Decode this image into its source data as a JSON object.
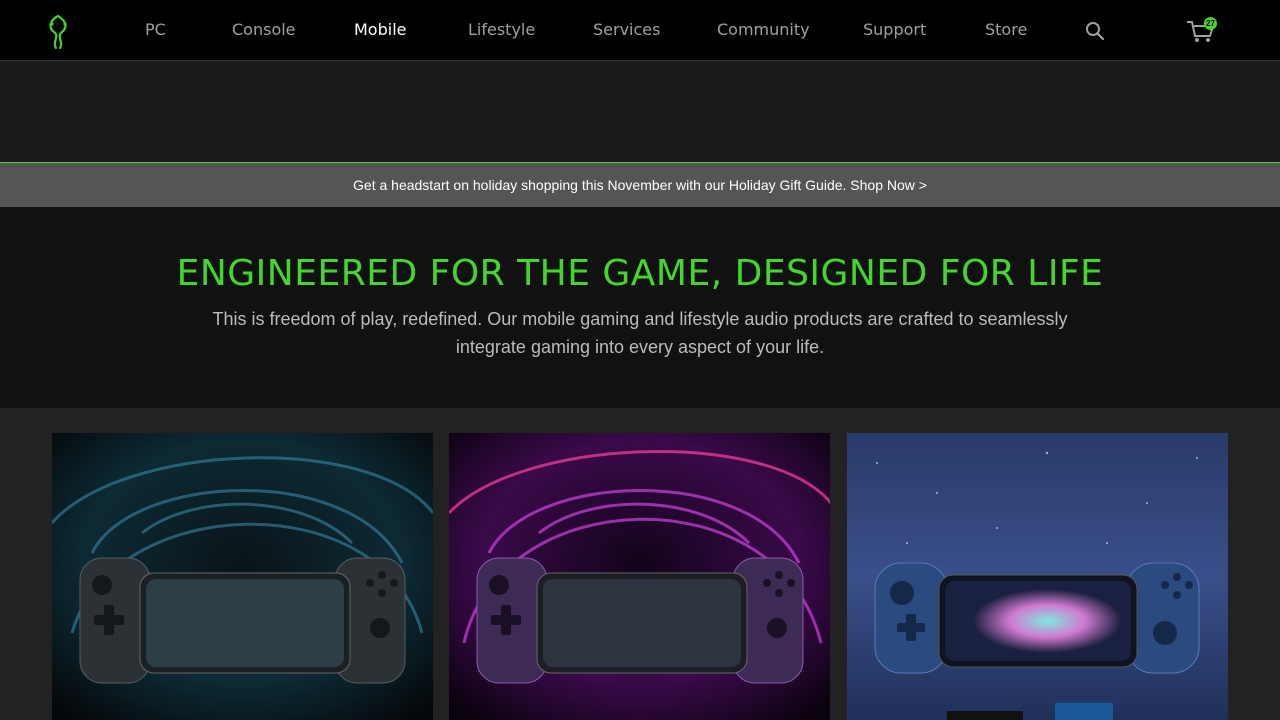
{
  "nav": {
    "items": [
      {
        "label": "PC"
      },
      {
        "label": "Console"
      },
      {
        "label": "Mobile",
        "active": true
      },
      {
        "label": "Lifestyle"
      },
      {
        "label": "Services"
      },
      {
        "label": "Community"
      },
      {
        "label": "Support"
      },
      {
        "label": "Store"
      }
    ],
    "cart_count": "27",
    "icons": {
      "logo": "razer-logo-icon",
      "search": "search-icon",
      "cart": "cart-icon"
    }
  },
  "promo": {
    "text": "Get a headstart on holiday shopping this November with our Holiday Gift Guide. Shop Now >"
  },
  "intro": {
    "title": "ENGINEERED FOR THE GAME, DESIGNED FOR LIFE",
    "description": "This is freedom of play, redefined. Our mobile gaming and lifestyle audio products are crafted to seamlessly integrate gaming into every aspect of your life."
  },
  "colors": {
    "accent": "#44d62c",
    "nav_bg": "#000000",
    "promo_bg": "#555555",
    "intro_bg": "#111111"
  },
  "products": [
    {
      "name": "kishi-v2-black",
      "accent": "#3a90b0"
    },
    {
      "name": "kishi-v2-purple",
      "accent": "#c030d0"
    },
    {
      "name": "kishi-v2-blue",
      "accent": "#3a5ea0"
    }
  ]
}
